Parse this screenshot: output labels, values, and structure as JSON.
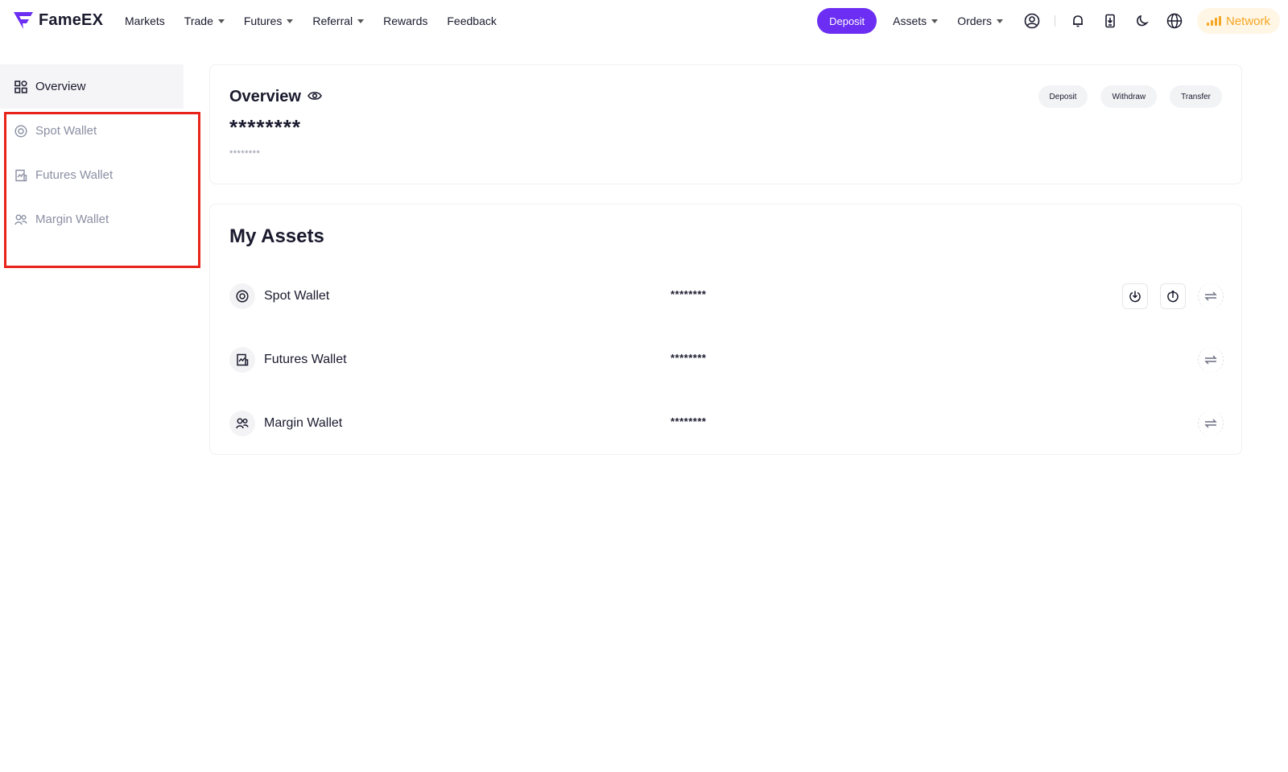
{
  "brand": {
    "name": "FameEX",
    "color": "#6b2ef2"
  },
  "nav": {
    "items": [
      {
        "label": "Markets",
        "dropdown": false
      },
      {
        "label": "Trade",
        "dropdown": true
      },
      {
        "label": "Futures",
        "dropdown": true
      },
      {
        "label": "Referral",
        "dropdown": true
      },
      {
        "label": "Rewards",
        "dropdown": false
      },
      {
        "label": "Feedback",
        "dropdown": false
      }
    ],
    "deposit_label": "Deposit",
    "assets_label": "Assets",
    "orders_label": "Orders",
    "network_label": "Network"
  },
  "sidebar": {
    "items": [
      {
        "label": "Overview",
        "icon": "grid-icon",
        "active": true
      },
      {
        "label": "Spot Wallet",
        "icon": "target-icon",
        "active": false
      },
      {
        "label": "Futures Wallet",
        "icon": "chart-doc-icon",
        "active": false
      },
      {
        "label": "Margin Wallet",
        "icon": "people-icon",
        "active": false
      }
    ]
  },
  "overview": {
    "title": "Overview",
    "balance": "********",
    "sub_balance": "********",
    "actions": {
      "deposit": "Deposit",
      "withdraw": "Withdraw",
      "transfer": "Transfer"
    }
  },
  "assets": {
    "title": "My Assets",
    "rows": [
      {
        "name": "Spot Wallet",
        "value": "********",
        "icon": "target-icon"
      },
      {
        "name": "Futures Wallet",
        "value": "********",
        "icon": "chart-doc-icon"
      },
      {
        "name": "Margin Wallet",
        "value": "********",
        "icon": "people-icon"
      }
    ]
  },
  "colors": {
    "accent": "#6b2ef2",
    "network": "#f5a623",
    "highlight": "#e8241a"
  }
}
